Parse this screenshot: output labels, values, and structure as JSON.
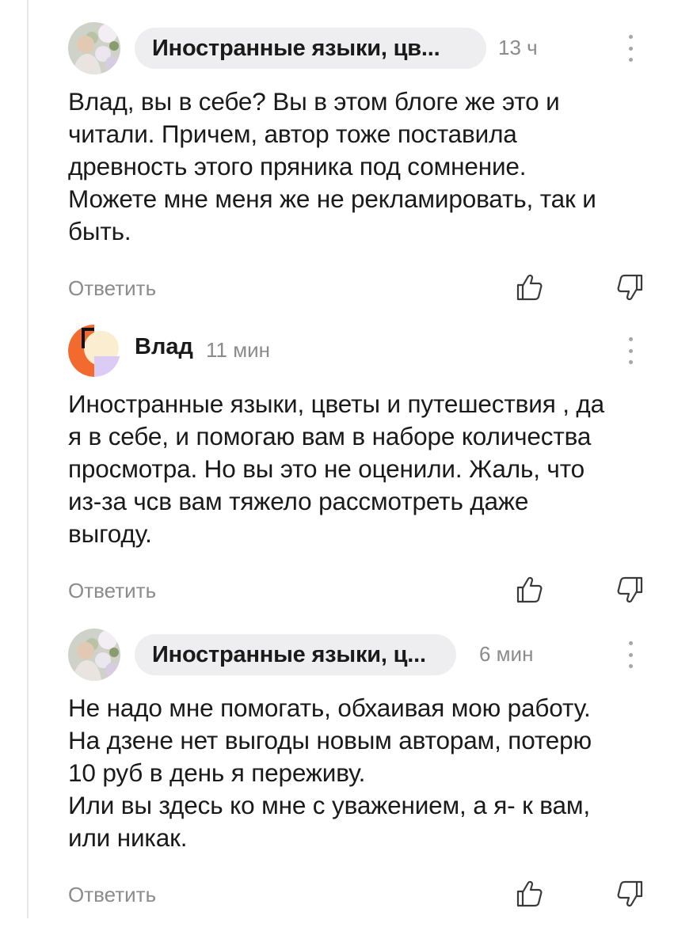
{
  "comments": [
    {
      "author": "Иностранные языки, цв...",
      "time": "13 ч",
      "text": "Влад, вы в себе? Вы в этом блоге же это и\nчитали. Причем, автор тоже поставила\nдревность этого пряника под сомнение.\nМожете мне меня же не рекламировать, так и\nбыть.",
      "reply": "Ответить"
    },
    {
      "author": "Влад",
      "time": "11 мин",
      "text": "Иностранные языки, цветы и путешествия , да\nя в себе, и помогаю вам в наборе количества\nпросмотра. Но вы это не оценили. Жаль, что\nиз-за чсв вам тяжело рассмотреть даже\nвыгоду.",
      "reply": "Ответить"
    },
    {
      "author": "Иностранные языки, ц...",
      "time": "6 мин",
      "text": "Не надо мне помогать, обхаивая мою работу.\nНа дзене нет выгоды новым авторам, потерю\n10 руб в день я переживу.\nИли вы здесь ко мне с уважением, а я- к вам,\nили никак.",
      "reply": "Ответить"
    }
  ],
  "icons": {
    "like": "thumbs-up-icon",
    "dislike": "thumbs-down-icon",
    "more": "more-vertical-icon"
  },
  "colors": {
    "chip_bg": "#eeeef0",
    "meta_text": "#8b8b8b",
    "avatar_orange": "#f26a2e",
    "avatar_cream": "#fbeed0",
    "avatar_lavender": "#dccbf5"
  }
}
